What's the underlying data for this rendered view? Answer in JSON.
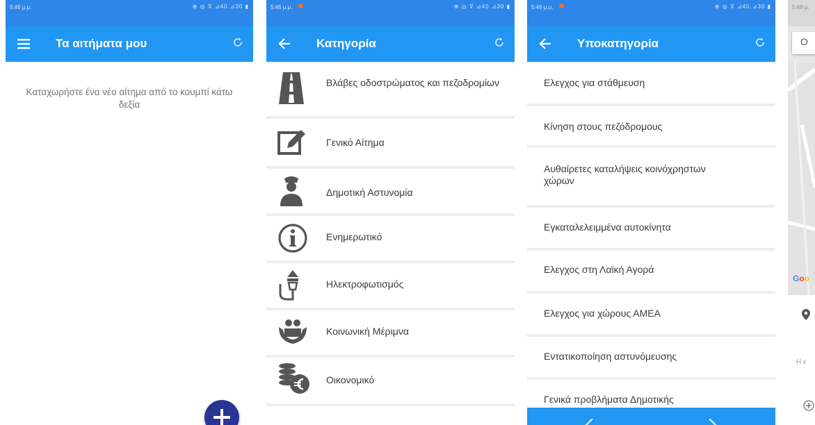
{
  "screens": [
    {
      "status_time": "5:46 μ.μ.",
      "status_icons": "⊕ ◎ ⊽ ⊿40.⊿30 ▮",
      "title": "Τα αιτήματα μου",
      "empty_message": "Καταχωρήστε ένα νέο αίτημα από το κουμπί κάτω δεξία"
    },
    {
      "status_time": "5:46 μ.μ.",
      "status_icons": "⊕ ◎ ⊽ ⊿40.⊿30 ▮",
      "title": "Κατηγορία",
      "items": [
        {
          "label": "Βλάβες οδοστρώματος και πεζοδρομίων",
          "icon": "road-icon"
        },
        {
          "label": "Γενικό Αίτημα",
          "icon": "edit-icon"
        },
        {
          "label": "Δημοτική Αστυνομία",
          "icon": "police-officer-icon"
        },
        {
          "label": "Ενημερωτικό",
          "icon": "info-icon"
        },
        {
          "label": "Ηλεκτροφωτισμός",
          "icon": "street-lamp-icon"
        },
        {
          "label": "Κοινωνική Μέριμνα",
          "icon": "family-care-icon"
        },
        {
          "label": "Οικονομικό",
          "icon": "coins-euro-icon"
        }
      ]
    },
    {
      "status_time": "5:46 μ.μ.",
      "status_icons": "⊕ ◎ ⊽ ⊿40.⊿30 ▮",
      "title": "Υποκατηγορία",
      "items": [
        {
          "label": "Ελεγχος για στάθμευση"
        },
        {
          "label": "Κίνηση στους πεζόδρομους"
        },
        {
          "label": "Αυθαίρετες καταλήψεις κοινόχρηστων χώρων"
        },
        {
          "label": "Εγκαταλελειμμένα αυτοκίνητα"
        },
        {
          "label": "Ελεγχος στη Λαϊκή Αγορά"
        },
        {
          "label": "Ελεγχος για χώρους ΑΜΕΑ"
        },
        {
          "label": "Εντατικοποίηση αστυνόμευσης"
        },
        {
          "label": "Γενικά προβλήματα Δημοτικής"
        }
      ]
    },
    {
      "status_time": "5:48 μ.",
      "search_glyph": "Ο",
      "google_label": "Goo",
      "address_prefix": "Η ε",
      "pin_glyph": "⬤"
    }
  ],
  "colors": {
    "primary": "#2196f3",
    "status": "#2e86e8",
    "fab": "#283593",
    "text": "#3a3a3a",
    "muted": "#757575"
  }
}
